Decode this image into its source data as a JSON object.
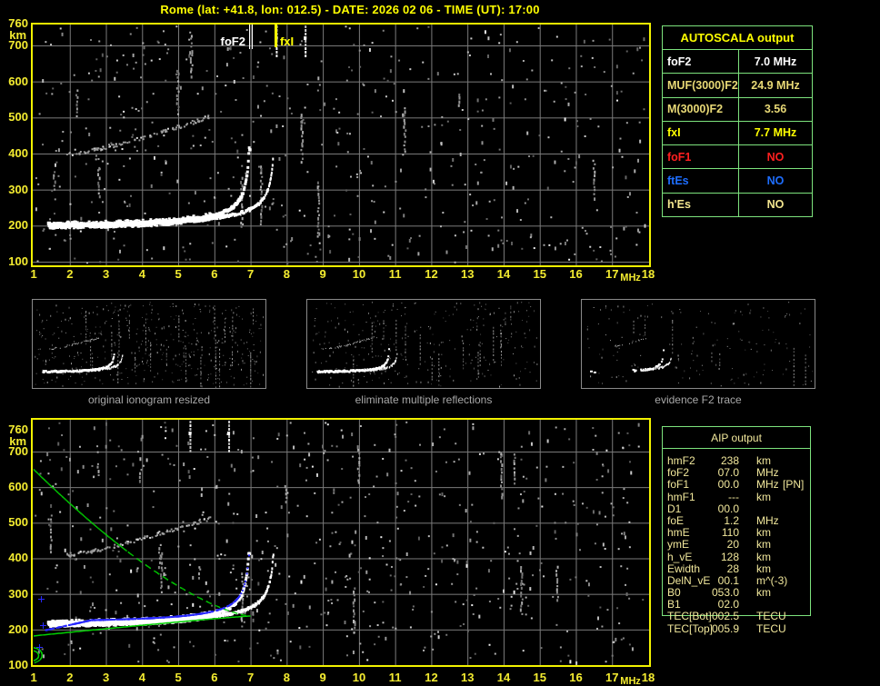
{
  "header": {
    "title": "Rome (lat: +41.8, lon: 012.5) - DATE: 2026 02 06 - TIME (UT): 17:00",
    "color": "#ffff00"
  },
  "colors": {
    "background": "#000000",
    "plot_border": "#f2f200",
    "grid": "#7b7b7b",
    "axis_text": "#f2ea30",
    "table_green": "#7de37d",
    "profile_green": "#00d200",
    "trace_white": "#ffffff",
    "trace_blue": "#2828ff",
    "hop_gray": "#9c9c9c",
    "caption_gray": "#a8a8a8"
  },
  "autoscala": {
    "title": "AUTOSCALA output",
    "rows": [
      {
        "label": "foF2",
        "value": "7.0 MHz",
        "color": "#ffffff"
      },
      {
        "label": "MUF(3000)F2",
        "value": "24.9 MHz",
        "color": "#e8d976"
      },
      {
        "label": "M(3000)F2",
        "value": "3.56",
        "color": "#e8d976"
      },
      {
        "label": "fxI",
        "value": "7.7 MHz",
        "color": "#ffff00"
      },
      {
        "label": "foF1",
        "value": "NO",
        "color": "#ff2020"
      },
      {
        "label": "ftEs",
        "value": "NO",
        "color": "#1e6eff"
      },
      {
        "label": "h'Es",
        "value": "NO",
        "color": "#f3e68f"
      }
    ]
  },
  "aip": {
    "title": "AIP output",
    "rows": [
      {
        "label": "hmF2",
        "value": "238",
        "unit": "km",
        "extra": ""
      },
      {
        "label": "foF2",
        "value": "07.0",
        "unit": "MHz",
        "extra": ""
      },
      {
        "label": "foF1",
        "value": "00.0",
        "unit": "MHz",
        "extra": "[PN]"
      },
      {
        "label": "hmF1",
        "value": "---",
        "unit": "km",
        "extra": ""
      },
      {
        "label": "D1",
        "value": "00.0",
        "unit": "",
        "extra": ""
      },
      {
        "label": "foE",
        "value": "1.2",
        "unit": "MHz",
        "extra": ""
      },
      {
        "label": "hmE",
        "value": "110",
        "unit": "km",
        "extra": ""
      },
      {
        "label": "ymE",
        "value": "20",
        "unit": "km",
        "extra": ""
      },
      {
        "label": "h_vE",
        "value": "128",
        "unit": "km",
        "extra": ""
      },
      {
        "label": "Ewidth",
        "value": "28",
        "unit": "km",
        "extra": ""
      },
      {
        "label": "DelN_vE",
        "value": "00.1",
        "unit": "m^(-3)",
        "extra": ""
      },
      {
        "label": "B0",
        "value": "053.0",
        "unit": "km",
        "extra": ""
      },
      {
        "label": "B1",
        "value": "02.0",
        "unit": "",
        "extra": ""
      },
      {
        "label": "TEC[Bot]",
        "value": "002.5",
        "unit": "TECU",
        "extra": ""
      },
      {
        "label": "TEC[Top]",
        "value": "005.9",
        "unit": "TECU",
        "extra": ""
      }
    ]
  },
  "thumbnails": [
    {
      "caption": "original ionogram resized",
      "mode": "full",
      "seed": 101,
      "noise_dots": 430,
      "noise_streaks": 26
    },
    {
      "caption": "eliminate multiple reflections",
      "mode": "full",
      "seed": 102,
      "noise_dots": 290,
      "noise_streaks": 16
    },
    {
      "caption": "evidence F2 trace",
      "mode": "f2only",
      "seed": 103,
      "noise_dots": 160,
      "noise_streaks": 7
    }
  ],
  "chart_data": [
    {
      "id": "top-ionogram",
      "type": "scatter",
      "title": "ionogram with AUTOSCALA scaled characteristics",
      "xlabel": "MHz",
      "ylabel": "km",
      "xlim": [
        1,
        18
      ],
      "ylim": [
        100,
        760
      ],
      "xticks": [
        1,
        2,
        3,
        4,
        5,
        6,
        7,
        8,
        9,
        10,
        11,
        12,
        13,
        14,
        15,
        16,
        17,
        18
      ],
      "yticks": [
        760,
        700,
        600,
        500,
        400,
        300,
        200,
        100
      ],
      "grid": true,
      "series": [
        {
          "name": "F2 ordinary trace",
          "kind": "otrace",
          "color": "#ffffff",
          "f_start": 1.42,
          "f_end": 6.98,
          "fc": 7.0,
          "h_base": 202,
          "h_cap": 415,
          "retardation": 30
        },
        {
          "name": "F2 extraordinary trace",
          "kind": "xtrace",
          "color": "#ffffff",
          "f_start": 5.45,
          "f_end": 7.64,
          "fc": 7.7,
          "h_base": 205,
          "h_cap": 412,
          "retardation": 30
        },
        {
          "name": "second hop reflection",
          "kind": "hop",
          "color": "#9c9c9c",
          "f_start": 1.9,
          "f_end": 5.85,
          "h_start": 400,
          "h_end": 505
        }
      ],
      "markers": [
        {
          "label": "foF2",
          "freq_mhz": 7.0,
          "color": "#ffffff",
          "style": "double-line"
        },
        {
          "label": "fxI",
          "freq_mhz": 7.7,
          "color": "#ffff00",
          "style": "thick-line"
        }
      ],
      "noise": {
        "seed": 11,
        "dots": 560,
        "streaks": 12,
        "bright_streaks": 2
      }
    },
    {
      "id": "bottom-ionogram",
      "type": "scatter",
      "title": "ionogram with AIP inverted profile",
      "xlabel": "MHz",
      "ylabel": "km",
      "xlim": [
        1,
        18
      ],
      "ylim": [
        100,
        760
      ],
      "xticks": [
        1,
        2,
        3,
        4,
        5,
        6,
        7,
        8,
        9,
        10,
        11,
        12,
        13,
        14,
        15,
        16,
        17,
        18
      ],
      "yticks": [
        760,
        700,
        600,
        500,
        400,
        300,
        200,
        100
      ],
      "grid": true,
      "series": [
        {
          "name": "F2 ordinary trace",
          "kind": "otrace",
          "color": "#ffffff",
          "f_start": 1.42,
          "f_end": 6.98,
          "fc": 7.0,
          "h_base": 218,
          "h_cap": 415,
          "retardation": 30
        },
        {
          "name": "F2 extraordinary trace",
          "kind": "xtrace",
          "color": "#ffffff",
          "f_start": 5.45,
          "f_end": 7.64,
          "fc": 7.7,
          "h_base": 221,
          "h_cap": 412,
          "retardation": 30
        },
        {
          "name": "second hop reflection",
          "kind": "hop",
          "color": "#9c9c9c",
          "f_start": 1.9,
          "f_end": 5.85,
          "h_start": 412,
          "h_end": 515
        }
      ],
      "markers": [],
      "profile": {
        "color": "#00d200",
        "foF2_mhz": 7.0,
        "hmF2_km": 238,
        "foE_mhz": 1.2,
        "hmE_km": 110,
        "top_height_km": 650,
        "bottom_start_km": 182
      },
      "model_trace": {
        "color": "#2828ff",
        "fc": 7.02,
        "h_base": 224,
        "h_cap": 408,
        "f_start": 1.32,
        "f_end": 6.97,
        "dip_until": 2.6,
        "dip_rate": 21
      },
      "plus_markers": [
        [
          1.2,
          287
        ],
        [
          1.26,
          213
        ],
        [
          1.14,
          151
        ]
      ],
      "noise": {
        "seed": 47,
        "dots": 640,
        "streaks": 14,
        "bright_streaks": 2
      }
    }
  ]
}
